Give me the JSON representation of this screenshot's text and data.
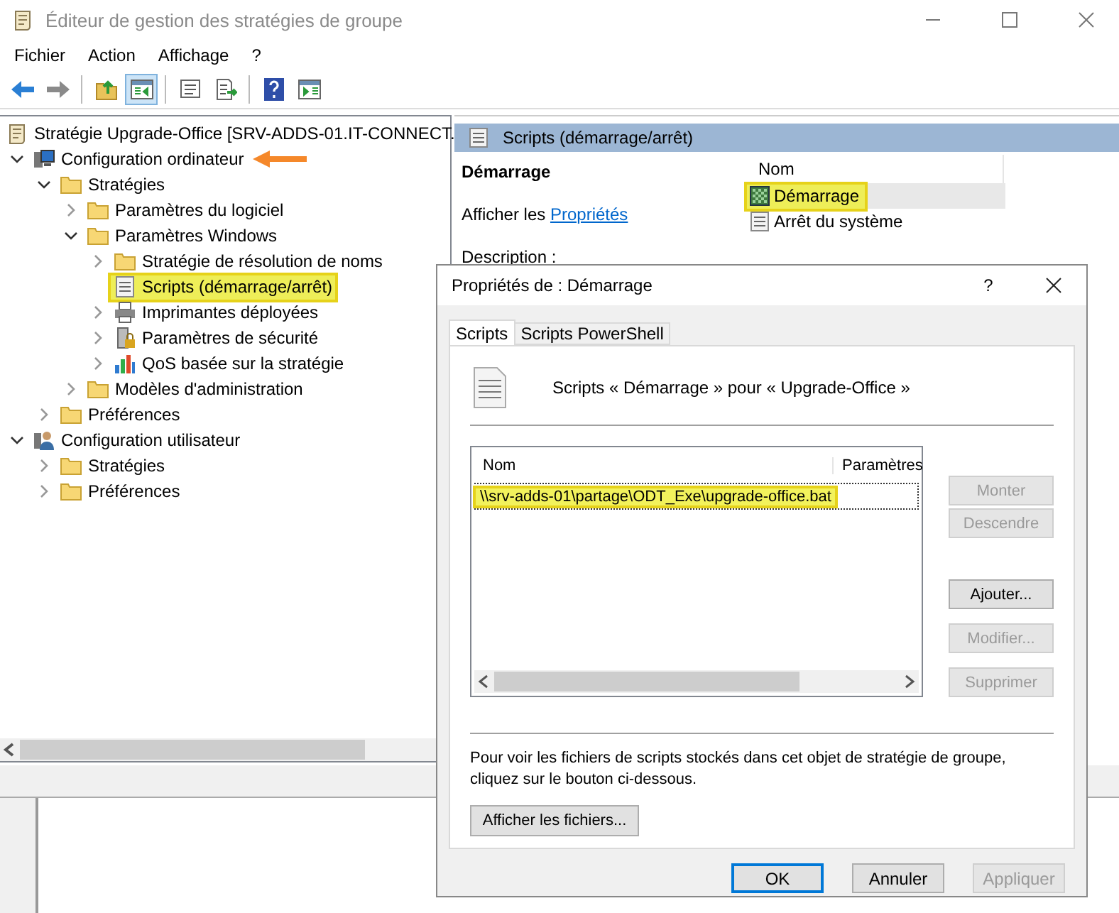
{
  "window": {
    "title": "Éditeur de gestion des stratégies de groupe"
  },
  "menu": [
    "Fichier",
    "Action",
    "Affichage",
    "?"
  ],
  "toolbar": [
    {
      "kind": "back",
      "disabled": false,
      "on": false
    },
    {
      "kind": "forward",
      "disabled": true,
      "on": false
    },
    {
      "kind": "sep"
    },
    {
      "kind": "up",
      "on": false
    },
    {
      "kind": "tree",
      "on": true
    },
    {
      "kind": "sep"
    },
    {
      "kind": "props",
      "on": false
    },
    {
      "kind": "export",
      "on": false
    },
    {
      "kind": "sep"
    },
    {
      "kind": "help",
      "on": false
    },
    {
      "kind": "pane",
      "on": false
    }
  ],
  "tree": [
    {
      "label": "Stratégie Upgrade-Office [SRV-ADDS-01.IT-CONNECT.",
      "kind": "policy",
      "selected": false,
      "children": [
        {
          "label": "Configuration ordinateur",
          "kind": "computer",
          "expanded": true,
          "selected": false,
          "pointer": true,
          "children": [
            {
              "label": "Stratégies",
              "kind": "folder",
              "expanded": true,
              "selected": false,
              "children": [
                {
                  "label": "Paramètres du logiciel",
                  "kind": "folder",
                  "expanded": false,
                  "selected": false
                },
                {
                  "label": "Paramètres Windows",
                  "kind": "folder",
                  "expanded": true,
                  "selected": false,
                  "children": [
                    {
                      "label": "Stratégie de résolution de noms",
                      "kind": "folder",
                      "expanded": false,
                      "selected": false
                    },
                    {
                      "label": "Scripts (démarrage/arrêt)",
                      "kind": "script",
                      "selected": true
                    },
                    {
                      "label": "Imprimantes déployées",
                      "kind": "printer",
                      "expanded": false,
                      "selected": false
                    },
                    {
                      "label": "Paramètres de sécurité",
                      "kind": "security",
                      "expanded": false,
                      "selected": false
                    },
                    {
                      "label": "QoS basée sur la stratégie",
                      "kind": "chart",
                      "expanded": false,
                      "selected": false
                    }
                  ]
                },
                {
                  "label": "Modèles d'administration",
                  "kind": "folder",
                  "expanded": false,
                  "selected": false
                }
              ]
            },
            {
              "label": "Préférences",
              "kind": "folder",
              "expanded": false,
              "selected": false
            }
          ]
        },
        {
          "label": "Configuration utilisateur",
          "kind": "user",
          "expanded": true,
          "selected": false,
          "children": [
            {
              "label": "Stratégies",
              "kind": "folder",
              "expanded": false,
              "selected": false
            },
            {
              "label": "Préférences",
              "kind": "folder",
              "expanded": false,
              "selected": false
            }
          ]
        }
      ]
    }
  ],
  "details": {
    "header": "Scripts (démarrage/arrêt)",
    "title": "Démarrage",
    "link_prefix": "Afficher les",
    "link": "Propriétés",
    "description": "Description :"
  },
  "list": {
    "column": "Nom",
    "items": [
      {
        "label": "Démarrage",
        "kind": "startup",
        "selected": true
      },
      {
        "label": "Arrêt du système",
        "kind": "script",
        "selected": false
      }
    ]
  },
  "dialog": {
    "title": "Propriétés de : Démarrage",
    "help": "?",
    "tabs": [
      {
        "label": "Scripts",
        "selected": true
      },
      {
        "label": "Scripts PowerShell",
        "selected": false
      }
    ],
    "heading": "Scripts « Démarrage » pour « Upgrade-Office »",
    "columns": [
      "Nom",
      "Paramètres"
    ],
    "rows": [
      {
        "name": "\\\\srv-adds-01\\partage\\ODT_Exe\\upgrade-office.bat",
        "selected": true
      }
    ],
    "side_buttons": [
      {
        "label": "Monter",
        "disabled": true
      },
      {
        "label": "Descendre",
        "disabled": true
      },
      {
        "label": "Ajouter...",
        "disabled": false
      },
      {
        "label": "Modifier...",
        "disabled": true
      },
      {
        "label": "Supprimer",
        "disabled": true
      }
    ],
    "note": "Pour voir les fichiers de scripts stockés dans cet objet de stratégie de groupe, cliquez sur le bouton ci-dessous.",
    "files_button": "Afficher les fichiers...",
    "buttons": [
      {
        "label": "OK",
        "disabled": false,
        "focused": true
      },
      {
        "label": "Annuler",
        "disabled": false,
        "focused": false
      },
      {
        "label": "Appliquer",
        "disabled": true,
        "focused": false
      }
    ]
  }
}
